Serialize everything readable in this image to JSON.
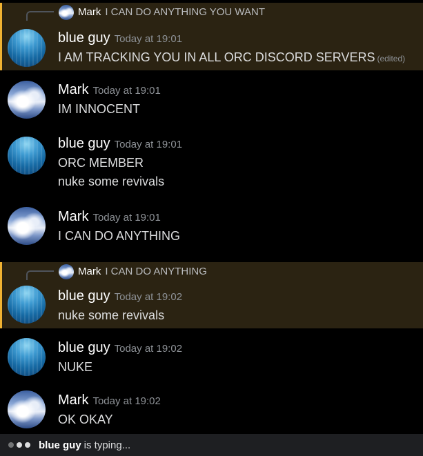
{
  "messages": [
    {
      "author": "blue guy",
      "avatar": "blue-guy-avatar",
      "time": "Today at 19:01",
      "highlighted": true,
      "reply": {
        "author": "Mark",
        "text": "I CAN DO ANYTHING YOU WANT"
      },
      "lines": [
        "I AM TRACKING YOU IN ALL ORC DISCORD SERVERS"
      ],
      "edited": "(edited)"
    },
    {
      "author": "Mark",
      "avatar": "mark-avatar",
      "time": "Today at 19:01",
      "lines": [
        "IM INNOCENT"
      ]
    },
    {
      "author": "blue guy",
      "avatar": "blue-guy-avatar",
      "time": "Today at 19:01",
      "lines": [
        "ORC MEMBER",
        "nuke some revivals"
      ]
    },
    {
      "author": "Mark",
      "avatar": "mark-avatar",
      "time": "Today at 19:01",
      "lines": [
        "I CAN DO ANYTHING"
      ]
    },
    {
      "author": "blue guy",
      "avatar": "blue-guy-avatar",
      "time": "Today at 19:02",
      "highlighted": true,
      "reply": {
        "author": "Mark",
        "text": "I CAN DO ANYTHING"
      },
      "lines": [
        "nuke some revivals"
      ]
    },
    {
      "author": "blue guy",
      "avatar": "blue-guy-avatar",
      "time": "Today at 19:02",
      "lines": [
        "NUKE"
      ]
    },
    {
      "author": "Mark",
      "avatar": "mark-avatar",
      "time": "Today at 19:02",
      "lines": [
        "OK OKAY"
      ]
    }
  ],
  "typing": {
    "user": "blue guy",
    "suffix": "is typing..."
  },
  "colors": {
    "highlight_bg": "#2b2312",
    "highlight_border": "#f0b232",
    "background": "#000000",
    "typing_bar": "#1e1f22"
  }
}
